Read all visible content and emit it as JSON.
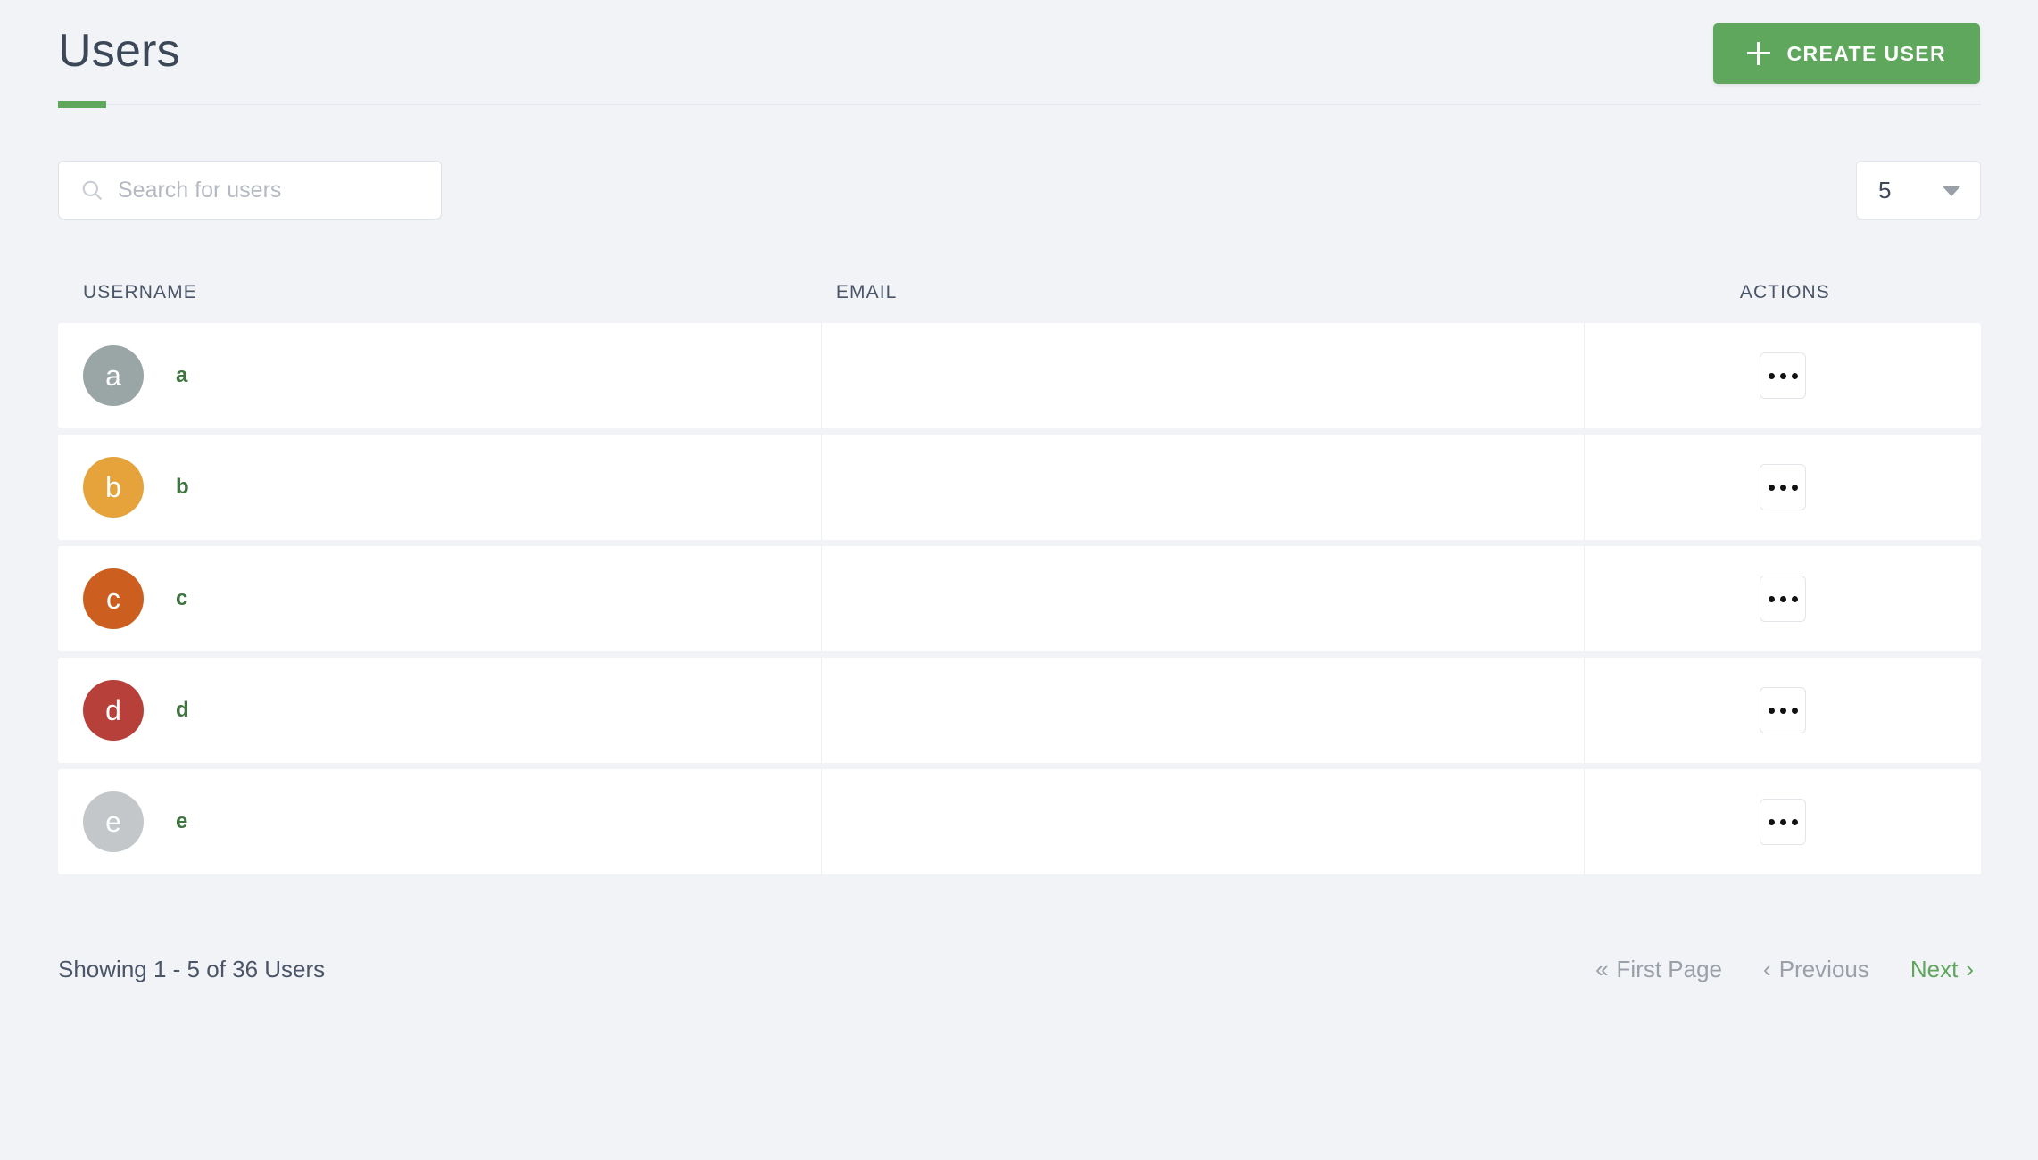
{
  "header": {
    "title": "Users",
    "create_button": {
      "label": "CREATE USER",
      "icon": "plus-icon",
      "color": "#5ea75c"
    },
    "tab_indicator_color": "#5ea75c"
  },
  "toolbar": {
    "search": {
      "placeholder": "Search for users",
      "value": "",
      "icon": "search-icon"
    },
    "page_size": {
      "value": "5",
      "icon": "chevron-down-icon"
    }
  },
  "table": {
    "columns": [
      {
        "key": "username",
        "label": "USERNAME"
      },
      {
        "key": "email",
        "label": "EMAIL"
      },
      {
        "key": "actions",
        "label": "ACTIONS"
      }
    ],
    "rows": [
      {
        "initial": "a",
        "username": "a",
        "email": "",
        "avatar_color": "#9aa5a5",
        "action_icon": "more-options-icon"
      },
      {
        "initial": "b",
        "username": "b",
        "email": "",
        "avatar_color": "#e6a33c",
        "action_icon": "more-options-icon"
      },
      {
        "initial": "c",
        "username": "c",
        "email": "",
        "avatar_color": "#cc5f1f",
        "action_icon": "more-options-icon"
      },
      {
        "initial": "d",
        "username": "d",
        "email": "",
        "avatar_color": "#b8403a",
        "action_icon": "more-options-icon"
      },
      {
        "initial": "e",
        "username": "e",
        "email": "",
        "avatar_color": "#c3c7c9",
        "action_icon": "more-options-icon"
      }
    ]
  },
  "footer": {
    "showing": "Showing 1 - 5 of 36 Users",
    "pagination": {
      "first_page": {
        "label": "First Page",
        "chevron": "«",
        "enabled": false
      },
      "previous": {
        "label": "Previous",
        "chevron": "‹",
        "enabled": false
      },
      "next": {
        "label": "Next",
        "chevron": "›",
        "enabled": true
      }
    },
    "disabled_color": "#9aa0a8",
    "active_color": "#5ea75c"
  }
}
